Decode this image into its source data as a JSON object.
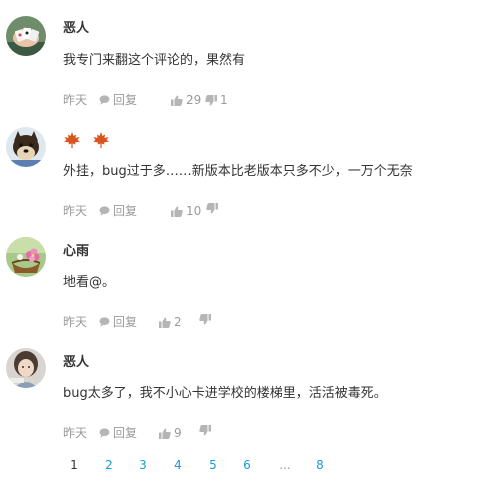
{
  "comments": [
    {
      "username": "恶人",
      "content": "我专门来翻这个评论的，果然有",
      "time": "昨天",
      "reply_label": "回复",
      "likes": "29",
      "dislikes": "1",
      "avatar": "avatar-hands-cards"
    },
    {
      "username": "",
      "badges": [
        "maple-leaf-icon",
        "maple-leaf-icon"
      ],
      "content": "外挂，bug过于多……新版本比老版本只多不少，一万个无奈",
      "time": "昨天",
      "reply_label": "回复",
      "likes": "10",
      "dislikes": "",
      "avatar": "avatar-shiba-dog"
    },
    {
      "username": "心雨",
      "content": "地看@。",
      "time": "昨天",
      "reply_label": "回复",
      "likes": "2",
      "dislikes": "",
      "avatar": "avatar-flower-basket"
    },
    {
      "username": "恶人",
      "content": "bug太多了，我不小心卡进学校的楼梯里，活活被毒死。",
      "time": "昨天",
      "reply_label": "回复",
      "likes": "9",
      "dislikes": "",
      "avatar": "avatar-girl-photo"
    }
  ],
  "pagination": {
    "pages": [
      "1",
      "2",
      "3",
      "4",
      "5",
      "6",
      "...",
      "8"
    ],
    "current": "1"
  },
  "colors": {
    "text": "#333333",
    "meta": "#9a9a9a",
    "link": "#1a9bd7",
    "icon": "#b5b5b5",
    "maple": "#d9531e"
  }
}
